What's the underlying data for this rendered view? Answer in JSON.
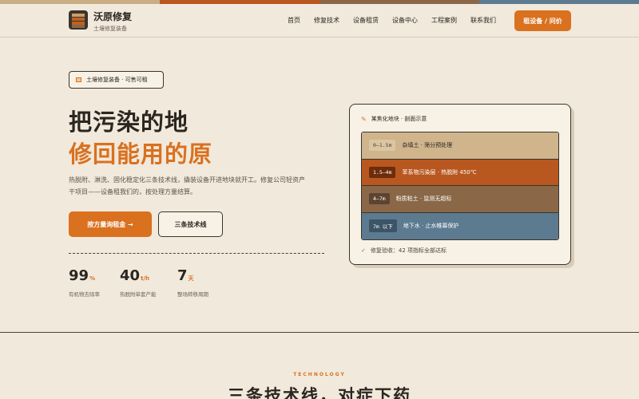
{
  "colors": {
    "accent": "#d9711f",
    "dark": "#2b2620",
    "background": "#f1e9dc",
    "strip": [
      "#c9ad85",
      "#b8571f",
      "#8a6747",
      "#5c7a90"
    ]
  },
  "brand": {
    "name": "沃原修复",
    "subtitle": "土壤修复装备",
    "logo_icon": "soil-layers-icon"
  },
  "nav": {
    "items": [
      "首页",
      "修复技术",
      "设备租赁",
      "设备中心",
      "工程案例",
      "联系我们"
    ],
    "cta": "租设备 / 问价"
  },
  "hero": {
    "badge": "土壤修复装备 · 可售可租",
    "title_line1": "把污染的地",
    "title_line2": "修回能用的原",
    "description": "热脱附、淋洗、固化稳定化三条技术线，撬装设备开进地块就开工。修复公司轻资产干项目——设备租我们的，按处理方量结算。",
    "primary_button": "按方量询租金 →",
    "secondary_button": "三条技术线"
  },
  "stats": [
    {
      "value": "99",
      "unit": "%",
      "label": "有机物去除率"
    },
    {
      "value": "40",
      "unit": "t/h",
      "label": "热脱附单套产能"
    },
    {
      "value": "7",
      "unit": "天",
      "label": "整场转移周期"
    }
  ],
  "card": {
    "title": "某焦化地块 · 剖面示意",
    "title_icon": "pin-icon",
    "layers": [
      {
        "depth": "0–1.5m",
        "text": "杂填土 · 筛分预处理"
      },
      {
        "depth": "1.5–4m",
        "text": "苯系物污染层 · 热脱附 450℃"
      },
      {
        "depth": "4–7m",
        "text": "粉质粘土 · 监测无超标"
      },
      {
        "depth": "7m 以下",
        "text": "地下水 · 止水帷幕保护"
      }
    ],
    "footer": "修复验收：42 项指标全部达标",
    "footer_icon": "check-icon"
  },
  "section": {
    "eyebrow": "TECHNOLOGY",
    "title": "三条技术线，对症下药"
  }
}
